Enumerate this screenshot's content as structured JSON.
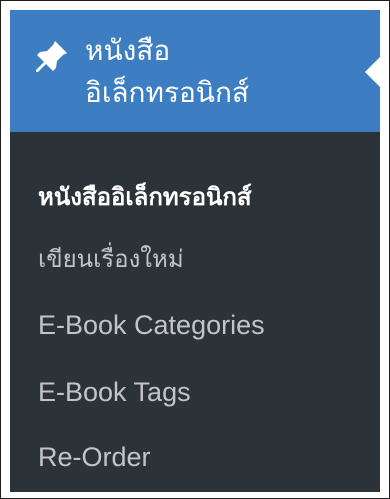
{
  "menu": {
    "header": {
      "icon": "pushpin-icon",
      "label_line1": "หนังสือ",
      "label_line2": "อิเล็กทรอนิกส์"
    },
    "submenu": [
      {
        "label": "หนังสืออิเล็กทรอนิกส์",
        "current": true
      },
      {
        "label": "เขียนเรื่องใหม่",
        "current": false
      },
      {
        "label": "E-Book Categories",
        "current": false
      },
      {
        "label": "E-Book Tags",
        "current": false
      },
      {
        "label": "Re-Order",
        "current": false
      }
    ],
    "colors": {
      "header_bg": "#3d7ec3",
      "menu_bg": "#2c3338",
      "item_text": "#c3c4c7",
      "current_text": "#ffffff"
    }
  }
}
